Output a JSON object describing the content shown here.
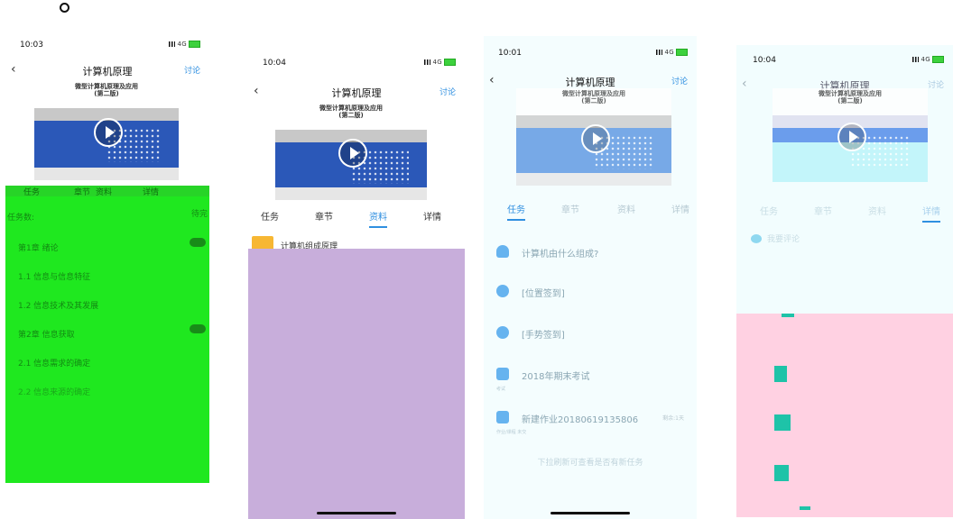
{
  "screens": [
    {
      "time": "10:03",
      "network": "4G",
      "title": "计算机原理",
      "discuss": "讨论",
      "video_caption": "微型计算机原理及应用\n(第二版)",
      "tabs": [
        "任务",
        "章节",
        "资料",
        "详情"
      ],
      "green_rows": [
        "任务数:",
        "第1章 绪论",
        "1.1 信息与信息特征",
        "1.2 信息技术及其发展",
        "第2章 信息获取",
        "2.1 信息需求的确定",
        "2.2 信息来源的确定"
      ],
      "right_label": "待完"
    },
    {
      "time": "10:04",
      "network": "4G",
      "title": "计算机原理",
      "discuss": "讨论",
      "video_caption": "微型计算机原理及应用\n(第二版)",
      "tabs": [
        "任务",
        "章节",
        "资料",
        "详情"
      ],
      "resource": "计算机组成原理"
    },
    {
      "time": "10:01",
      "network": "4G",
      "title": "计算机原理",
      "discuss": "讨论",
      "video_caption": "微型计算机原理及应用\n(第二版)",
      "tabs": [
        "任务",
        "章节",
        "资料",
        "详情"
      ],
      "tasks": [
        {
          "text": "计算机由什么组成?",
          "icon": "person-icon",
          "sub": "",
          "right": ""
        },
        {
          "text": "[位置签到]",
          "icon": "hand-icon",
          "sub": "",
          "right": ""
        },
        {
          "text": "[手势签到]",
          "icon": "hand-icon",
          "sub": "",
          "right": ""
        },
        {
          "text": "2018年期末考试",
          "icon": "exam-icon",
          "sub": "考试",
          "right": ""
        },
        {
          "text": "新建作业20180619135806",
          "icon": "homework-icon",
          "sub": "作业/课程 未交",
          "right": "剩余:1天"
        }
      ],
      "hint": "下拉刷新可查看是否有新任务"
    },
    {
      "time": "10:04",
      "network": "4G",
      "title": "计算机原理",
      "discuss": "讨论",
      "video_caption": "微型计算机原理及应用\n(第二版)",
      "tabs": [
        "任务",
        "章节",
        "资料",
        "详情"
      ],
      "comment": "我要评论"
    }
  ],
  "colors": {
    "accent": "#2f8fe0",
    "green_overlay": "#1fe81f",
    "purple_overlay": "#c8aedb",
    "pink_overlay": "#ffd1e2",
    "book_blue": "#2b58b8"
  }
}
